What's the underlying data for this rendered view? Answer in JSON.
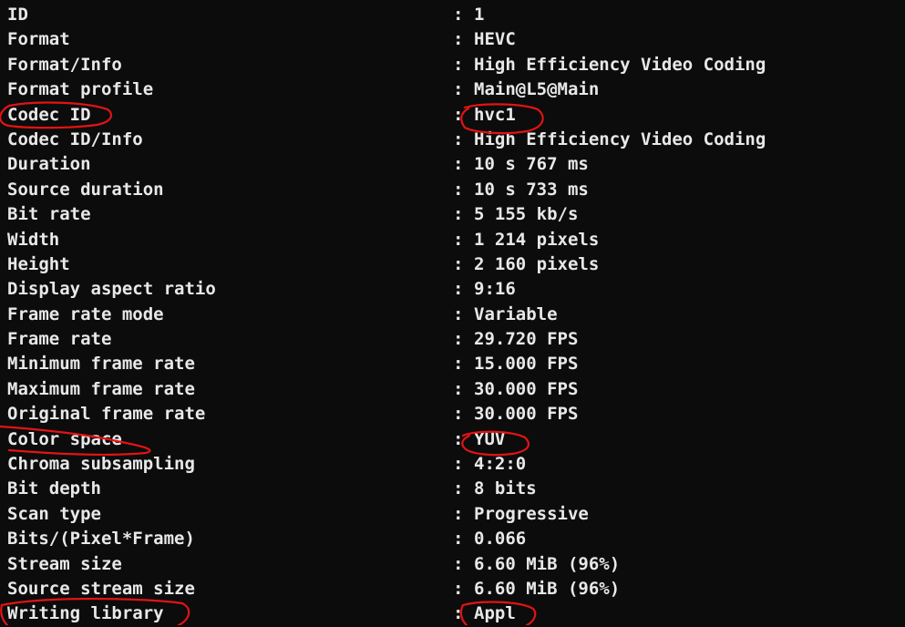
{
  "separator": ":",
  "rows": [
    {
      "key": "ID",
      "value": "1"
    },
    {
      "key": "Format",
      "value": "HEVC"
    },
    {
      "key": "Format/Info",
      "value": "High Efficiency Video Coding"
    },
    {
      "key": "Format profile",
      "value": "Main@L5@Main"
    },
    {
      "key": "Codec ID",
      "value": "hvc1"
    },
    {
      "key": "Codec ID/Info",
      "value": "High Efficiency Video Coding"
    },
    {
      "key": "Duration",
      "value": "10 s 767 ms"
    },
    {
      "key": "Source duration",
      "value": "10 s 733 ms"
    },
    {
      "key": "Bit rate",
      "value": "5 155 kb/s"
    },
    {
      "key": "Width",
      "value": "1 214 pixels"
    },
    {
      "key": "Height",
      "value": "2 160 pixels"
    },
    {
      "key": "Display aspect ratio",
      "value": "9:16"
    },
    {
      "key": "Frame rate mode",
      "value": "Variable"
    },
    {
      "key": "Frame rate",
      "value": "29.720 FPS"
    },
    {
      "key": "Minimum frame rate",
      "value": "15.000 FPS"
    },
    {
      "key": "Maximum frame rate",
      "value": "30.000 FPS"
    },
    {
      "key": "Original frame rate",
      "value": "30.000 FPS"
    },
    {
      "key": "Color space",
      "value": "YUV"
    },
    {
      "key": "Chroma subsampling",
      "value": "4:2:0"
    },
    {
      "key": "Bit depth",
      "value": "8 bits"
    },
    {
      "key": "Scan type",
      "value": "Progressive"
    },
    {
      "key": "Bits/(Pixel*Frame)",
      "value": "0.066"
    },
    {
      "key": "Stream size",
      "value": "6.60 MiB (96%)"
    },
    {
      "key": "Source stream size",
      "value": "6.60 MiB (96%)"
    },
    {
      "key": "Writing library",
      "value": "Appl"
    }
  ],
  "colors": {
    "background": "#0c0c0c",
    "text": "#e8e8e8",
    "annotation": "#e31313"
  }
}
